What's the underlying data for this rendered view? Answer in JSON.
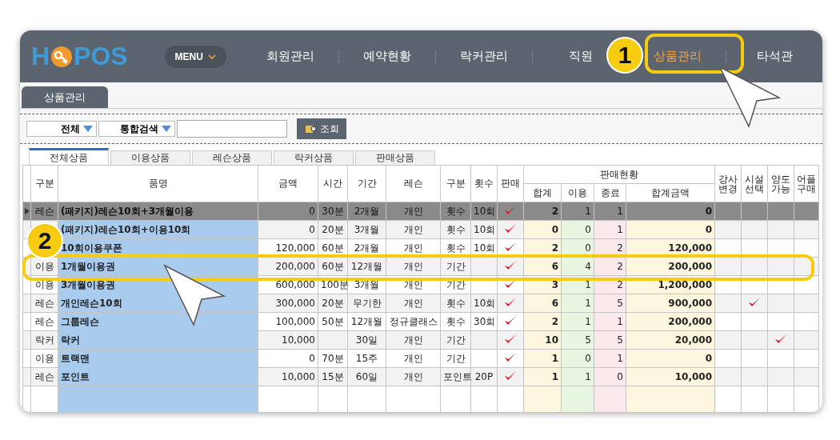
{
  "logo": {
    "left": "H",
    "right": "POS"
  },
  "menu_button": {
    "label": "MENU"
  },
  "nav": [
    {
      "label": "회원관리",
      "selected": false
    },
    {
      "label": "예약현황",
      "selected": false
    },
    {
      "label": "락커관리",
      "selected": false
    },
    {
      "label": "직원",
      "selected": false
    },
    {
      "label": "상품관리",
      "selected": true
    },
    {
      "label": "타석관",
      "selected": false
    }
  ],
  "page_tab": {
    "label": "상품관리"
  },
  "search": {
    "filter": "전체",
    "scope": "통합검색",
    "button": "조회"
  },
  "product_tabs": [
    {
      "label": "전체상품",
      "selected": true
    },
    {
      "label": "이용상품",
      "selected": false
    },
    {
      "label": "레슨상품",
      "selected": false
    },
    {
      "label": "락커상품",
      "selected": false
    },
    {
      "label": "판매상품",
      "selected": false
    }
  ],
  "table": {
    "left_columns": [
      "구분",
      "품명",
      "금액",
      "시간",
      "기간",
      "레슨",
      "구분",
      "횟수",
      "판매"
    ],
    "sales_group": {
      "label": "판매현황",
      "columns": [
        "합계",
        "이용",
        "종료",
        "합계금액"
      ]
    },
    "right_columns": [
      "강사변경",
      "시설선택",
      "양도가능",
      "어플구매"
    ],
    "rows": [
      {
        "selected": true,
        "type": "레슨",
        "name": "(패키지)레슨10회+3개월이용",
        "price": "0",
        "time": "30분",
        "period": "2개월",
        "lesson": "개인",
        "unit": "횟수",
        "count": "10회",
        "on_sale": true,
        "total": "2",
        "used": "1",
        "ended": "1",
        "amount": "0",
        "instructor_change": false,
        "facility_select": false,
        "transferable": false,
        "app_purchase": false
      },
      {
        "selected": false,
        "name": "(패키지)레슨10회+이용10회",
        "price": "0",
        "time": "20분",
        "period": "3개월",
        "lesson": "개인",
        "unit": "횟수",
        "count": "10회",
        "on_sale": true,
        "total": "0",
        "used": "0",
        "ended": "1",
        "amount": "0",
        "instructor_change": false,
        "facility_select": false,
        "transferable": false,
        "app_purchase": false
      },
      {
        "selected": false,
        "name": "10회이용쿠폰",
        "price": "120,000",
        "time": "60분",
        "period": "2개월",
        "lesson": "개인",
        "unit": "횟수",
        "count": "10회",
        "on_sale": true,
        "total": "2",
        "used": "0",
        "ended": "2",
        "amount": "120,000",
        "instructor_change": false,
        "facility_select": false,
        "transferable": false,
        "app_purchase": false
      },
      {
        "selected": false,
        "type": "이용",
        "name": "1개월이용권",
        "price": "200,000",
        "time": "60분",
        "period": "12개월",
        "lesson": "개인",
        "unit": "기간",
        "on_sale": true,
        "total": "6",
        "used": "4",
        "ended": "2",
        "amount": "200,000",
        "instructor_change": false,
        "facility_select": false,
        "transferable": false,
        "app_purchase": false
      },
      {
        "selected": false,
        "type": "이용",
        "name": "3개월이용권",
        "price": "600,000",
        "time": "100분",
        "period": "3개월",
        "lesson": "개인",
        "unit": "기간",
        "on_sale": true,
        "total": "3",
        "used": "1",
        "ended": "2",
        "amount": "1,200,000",
        "instructor_change": false,
        "facility_select": false,
        "transferable": false,
        "app_purchase": false
      },
      {
        "selected": false,
        "type": "레슨",
        "name": "개인레슨10회",
        "price": "300,000",
        "time": "20분",
        "period": "무기한",
        "lesson": "개인",
        "unit": "횟수",
        "count": "10회",
        "on_sale": true,
        "total": "6",
        "used": "1",
        "ended": "5",
        "amount": "900,000",
        "instructor_change": false,
        "facility_select": true,
        "transferable": false,
        "app_purchase": false
      },
      {
        "selected": false,
        "type": "레슨",
        "name": "그룹레슨",
        "price": "100,000",
        "time": "50분",
        "period": "12개월",
        "lesson": "정규클래스",
        "unit": "횟수",
        "count": "30회",
        "on_sale": true,
        "total": "2",
        "used": "1",
        "ended": "1",
        "amount": "200,000",
        "instructor_change": false,
        "facility_select": false,
        "transferable": false,
        "app_purchase": false
      },
      {
        "selected": false,
        "type": "락커",
        "name": "락커",
        "price": "10,000",
        "period": "30일",
        "lesson": "개인",
        "unit": "기간",
        "on_sale": true,
        "total": "10",
        "used": "5",
        "ended": "5",
        "amount": "20,000",
        "instructor_change": false,
        "facility_select": false,
        "transferable": true,
        "app_purchase": false
      },
      {
        "selected": false,
        "type": "이용",
        "name": "트랙맨",
        "price": "0",
        "time": "70분",
        "period": "15주",
        "lesson": "개인",
        "unit": "기간",
        "on_sale": true,
        "total": "1",
        "used": "0",
        "ended": "1",
        "amount": "0",
        "instructor_change": false,
        "facility_select": false,
        "transferable": false,
        "app_purchase": false
      },
      {
        "selected": false,
        "type": "레슨",
        "name": "포인트",
        "price": "10,000",
        "time": "15분",
        "period": "60일",
        "lesson": "개인",
        "unit": "포인트",
        "count": "20P",
        "on_sale": true,
        "total": "1",
        "used": "1",
        "ended": "0",
        "amount": "10,000",
        "instructor_change": false,
        "facility_select": false,
        "transferable": false,
        "app_purchase": false
      }
    ]
  },
  "callouts": [
    {
      "label": "1"
    },
    {
      "label": "2"
    }
  ]
}
